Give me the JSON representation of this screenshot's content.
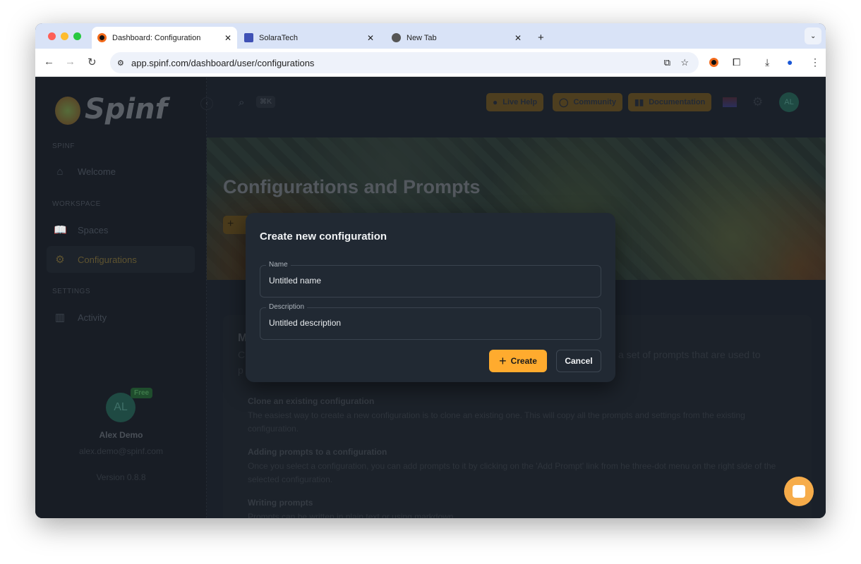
{
  "browser": {
    "tabs": [
      {
        "title": "Dashboard: Configuration",
        "active": true
      },
      {
        "title": "SolaraTech"
      },
      {
        "title": "New Tab"
      }
    ],
    "url": "app.spinf.com/dashboard/user/configurations"
  },
  "sidebar": {
    "logo": "Spinf",
    "sections": [
      {
        "label": "SPINF",
        "items": [
          {
            "label": "Welcome",
            "icon": "home-icon"
          }
        ]
      },
      {
        "label": "WORKSPACE",
        "items": [
          {
            "label": "Spaces",
            "icon": "book-icon"
          },
          {
            "label": "Configurations",
            "icon": "gear-icon",
            "active": true
          }
        ]
      },
      {
        "label": "SETTINGS",
        "items": [
          {
            "label": "Activity",
            "icon": "bar-chart-icon"
          }
        ]
      }
    ],
    "user": {
      "initials": "AL",
      "badge": "Free",
      "name": "Alex Demo",
      "email": "alex.demo@spinf.com",
      "version": "Version 0.8.8"
    }
  },
  "header": {
    "shortcut": "⌘K",
    "buttons": [
      "Live Help",
      "Community",
      "Documentation"
    ],
    "avatar": "AL",
    "accent": "#ffab2e"
  },
  "page": {
    "title": "Configurations and Prompts",
    "intro_fragments": [
      "M",
      "C",
      "p",
      "a set of prompts that are used to"
    ],
    "sections": [
      {
        "heading": "Clone an existing configuration",
        "body": "The easiest way to create a new configuration is to clone an existing one. This will copy all the prompts and settings from the existing configuration."
      },
      {
        "heading": "Adding prompts to a configuration",
        "body": "Once you select a configuration, you can add prompts to it by clicking on the 'Add Prompt' link from he three-dot menu on the right side of the selected configuration."
      },
      {
        "heading": "Writing prompts",
        "body": "Prompts can be written in plain text or using markdown."
      }
    ]
  },
  "modal": {
    "title": "Create new configuration",
    "name_label": "Name",
    "name_value": "Untitled name",
    "desc_label": "Description",
    "desc_value": "Untitled description",
    "create": "Create",
    "cancel": "Cancel"
  }
}
